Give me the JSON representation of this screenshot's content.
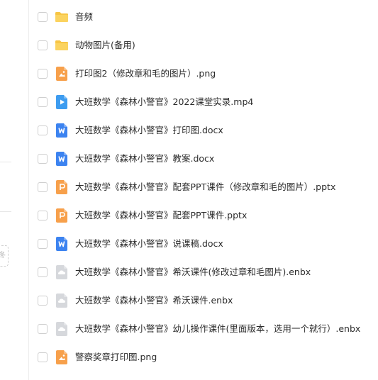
{
  "colors": {
    "folder": "#f7c544",
    "image": "#f7a04b",
    "video": "#3d9cf0",
    "word": "#3c83f0",
    "ppt": "#f7a04b",
    "cloud": "#d6d8dc"
  },
  "left_panel": {
    "partial_label": "冬"
  },
  "files": [
    {
      "name": "音频",
      "icon": "folder-icon"
    },
    {
      "name": "动物图片(备用)",
      "icon": "folder-icon"
    },
    {
      "name": "打印图2（修改章和毛的图片）.png",
      "icon": "image-icon"
    },
    {
      "name": "大班数学《森林小警官》2022课堂实录.mp4",
      "icon": "video-icon"
    },
    {
      "name": "大班数学《森林小警官》打印图.docx",
      "icon": "word-icon"
    },
    {
      "name": "大班数学《森林小警官》教案.docx",
      "icon": "word-icon"
    },
    {
      "name": "大班数学《森林小警官》配套PPT课件（修改章和毛的图片）.pptx",
      "icon": "ppt-icon"
    },
    {
      "name": "大班数学《森林小警官》配套PPT课件.pptx",
      "icon": "ppt-icon"
    },
    {
      "name": "大班数学《森林小警官》说课稿.docx",
      "icon": "word-icon"
    },
    {
      "name": "大班数学《森林小警官》希沃课件(修改过章和毛图片).enbx",
      "icon": "cloud-file-icon"
    },
    {
      "name": "大班数学《森林小警官》希沃课件.enbx",
      "icon": "cloud-file-icon"
    },
    {
      "name": "大班数学《森林小警官》幼儿操作课件(里面版本，选用一个就行）.enbx",
      "icon": "cloud-file-icon"
    },
    {
      "name": "警察奖章打印图.png",
      "icon": "image-icon"
    }
  ]
}
